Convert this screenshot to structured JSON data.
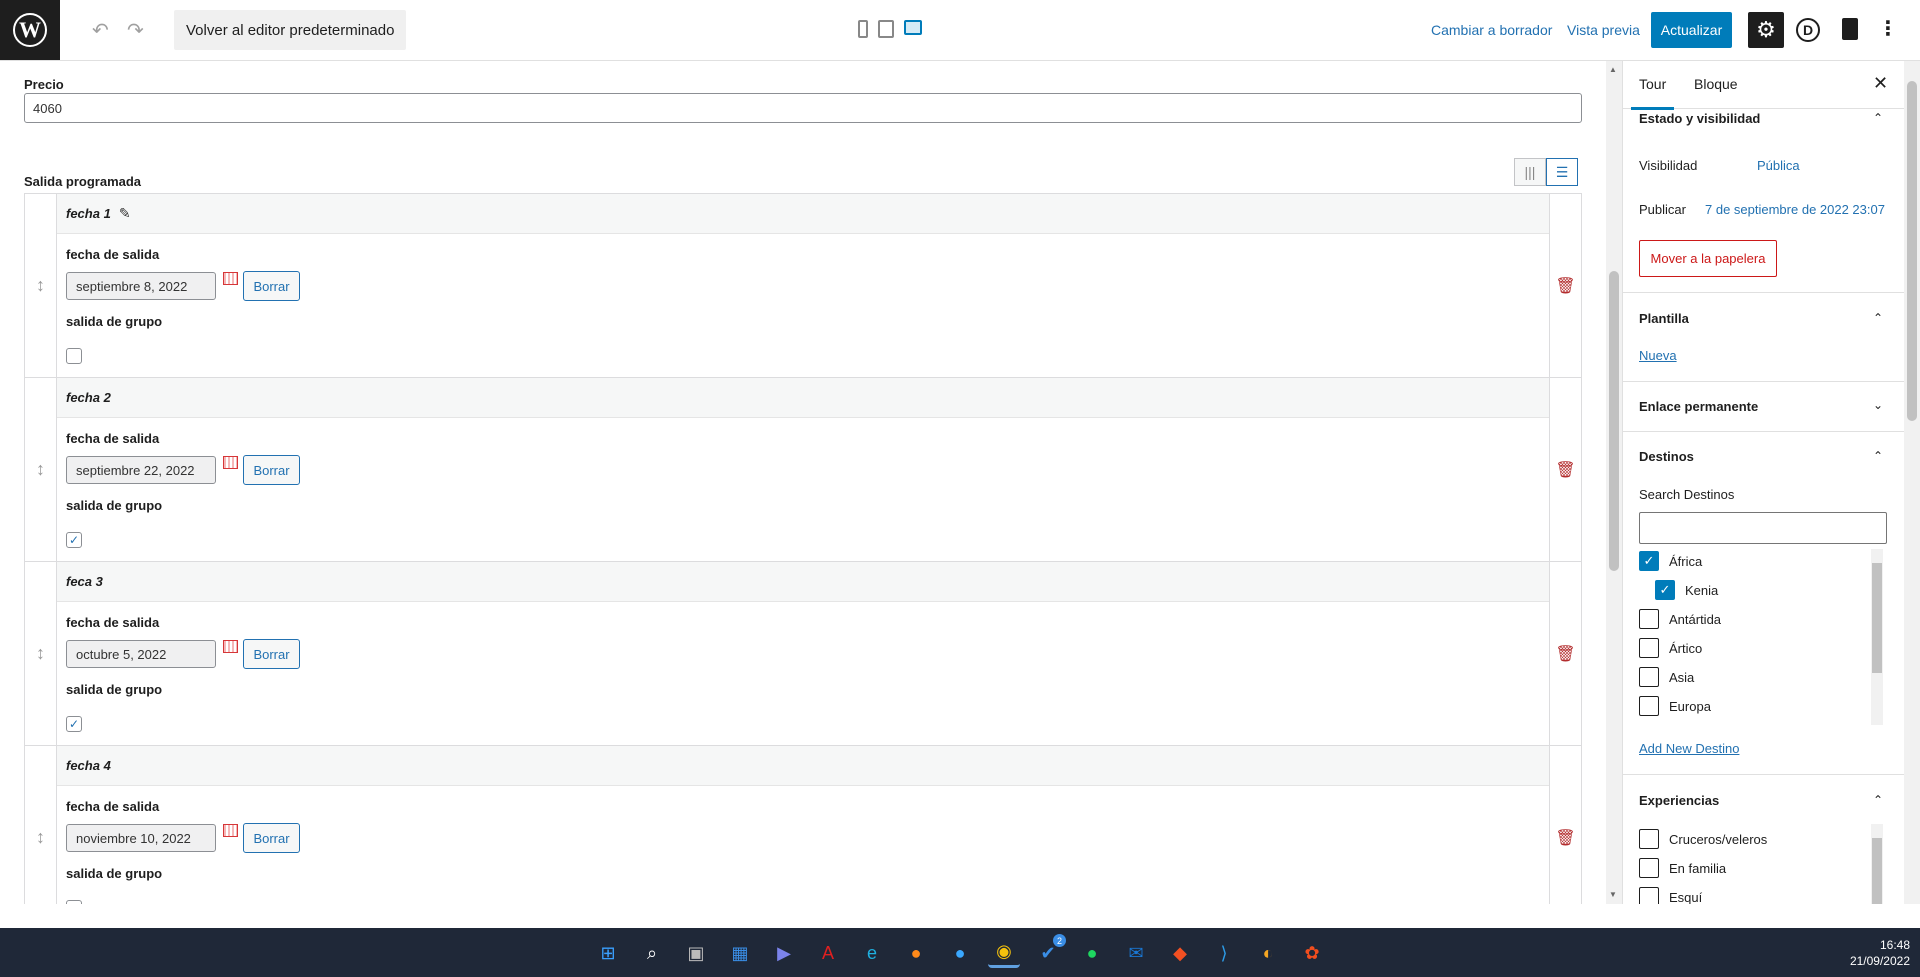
{
  "topbar": {
    "logo_letter": "W",
    "undo": "↶",
    "redo": "↷",
    "back_editor": "Volver al editor predeterminado",
    "switch_draft": "Cambiar a borrador",
    "preview": "Vista previa",
    "update": "Actualizar",
    "divi_letter": "D"
  },
  "main": {
    "precio_label": "Precio",
    "precio_value": "4060",
    "salida_label": "Salida programada",
    "rows": [
      {
        "title": "fecha 1",
        "date_label": "fecha de salida",
        "date": "septiembre 8, 2022",
        "clear": "Borrar",
        "group_label": "salida de grupo",
        "group_checked": false,
        "editing": true
      },
      {
        "title": "fecha 2",
        "date_label": "fecha de salida",
        "date": "septiembre 22, 2022",
        "clear": "Borrar",
        "group_label": "salida de grupo",
        "group_checked": true,
        "editing": false
      },
      {
        "title": "feca 3",
        "date_label": "fecha de salida",
        "date": "octubre 5, 2022",
        "clear": "Borrar",
        "group_label": "salida de grupo",
        "group_checked": true,
        "editing": false
      },
      {
        "title": "fecha 4",
        "date_label": "fecha de salida",
        "date": "noviembre 10, 2022",
        "clear": "Borrar",
        "group_label": "salida de grupo",
        "group_checked": true,
        "editing": false
      }
    ]
  },
  "sidebar": {
    "tab_tour": "Tour",
    "tab_block": "Bloque",
    "status_title": "Estado y visibilidad",
    "visibility_label": "Visibilidad",
    "visibility_value": "Pública",
    "publish_label": "Publicar",
    "publish_value": "7 de septiembre de 2022 23:07",
    "trash": "Mover a la papelera",
    "template_title": "Plantilla",
    "template_value": "Nueva",
    "permalink_title": "Enlace permanente",
    "destinos_title": "Destinos",
    "destinos_search": "Search Destinos",
    "destinos": [
      {
        "label": "África",
        "checked": true,
        "child": false
      },
      {
        "label": "Kenia",
        "checked": true,
        "child": true
      },
      {
        "label": "Antártida",
        "checked": false,
        "child": false
      },
      {
        "label": "Ártico",
        "checked": false,
        "child": false
      },
      {
        "label": "Asia",
        "checked": false,
        "child": false
      },
      {
        "label": "Europa",
        "checked": false,
        "child": false
      }
    ],
    "add_destino": "Add New Destino",
    "experiencias_title": "Experiencias",
    "experiencias": [
      {
        "label": "Cruceros/veleros",
        "checked": false
      },
      {
        "label": "En familia",
        "checked": false
      },
      {
        "label": "Esquí",
        "checked": false
      }
    ]
  },
  "taskbar": {
    "time": "16:48",
    "date": "21/09/2022",
    "steam_badge": "2"
  },
  "colors": {
    "accent": "#007cba",
    "danger": "#cc1818",
    "taskbar": "#1f2838"
  }
}
